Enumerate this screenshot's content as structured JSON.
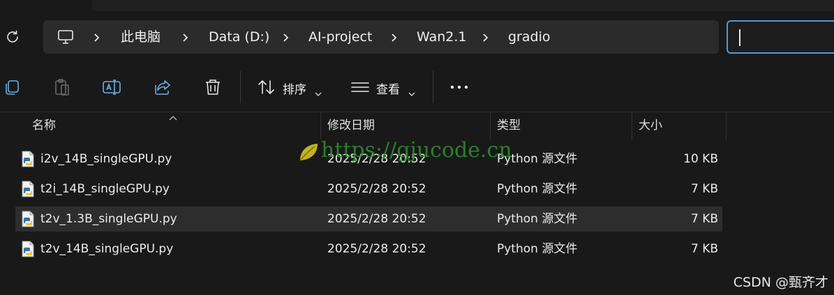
{
  "breadcrumb": {
    "items": [
      "此电脑",
      "Data (D:)",
      "AI-project",
      "Wan2.1",
      "gradio"
    ]
  },
  "search": {
    "placeholder": ""
  },
  "toolbar": {
    "sort_label": "排序",
    "view_label": "查看"
  },
  "columns": {
    "name": "名称",
    "modified": "修改日期",
    "type": "类型",
    "size": "大小"
  },
  "files": [
    {
      "name": "i2v_14B_singleGPU.py",
      "modified": "2025/2/28 20:52",
      "type": "Python 源文件",
      "size": "10 KB",
      "selected": false
    },
    {
      "name": "t2i_14B_singleGPU.py",
      "modified": "2025/2/28 20:52",
      "type": "Python 源文件",
      "size": "7 KB",
      "selected": false
    },
    {
      "name": "t2v_1.3B_singleGPU.py",
      "modified": "2025/2/28 20:52",
      "type": "Python 源文件",
      "size": "7 KB",
      "selected": true
    },
    {
      "name": "t2v_14B_singleGPU.py",
      "modified": "2025/2/28 20:52",
      "type": "Python 源文件",
      "size": "7 KB",
      "selected": false
    }
  ],
  "watermark": {
    "text": "https://gjucode.cn"
  },
  "credit": {
    "text": "CSDN @甄齐才"
  },
  "colors": {
    "accent": "#4c9bd6",
    "background": "#191919",
    "selected_row": "#2d2d2d",
    "watermark": "#2e8b2e"
  },
  "icons": [
    "refresh-icon",
    "computer-icon",
    "chevron-right-icon",
    "copy-icon",
    "paste-icon",
    "rename-icon",
    "share-icon",
    "delete-icon",
    "sort-icon",
    "view-icon",
    "more-icon",
    "python-file-icon",
    "leaf-icon"
  ]
}
